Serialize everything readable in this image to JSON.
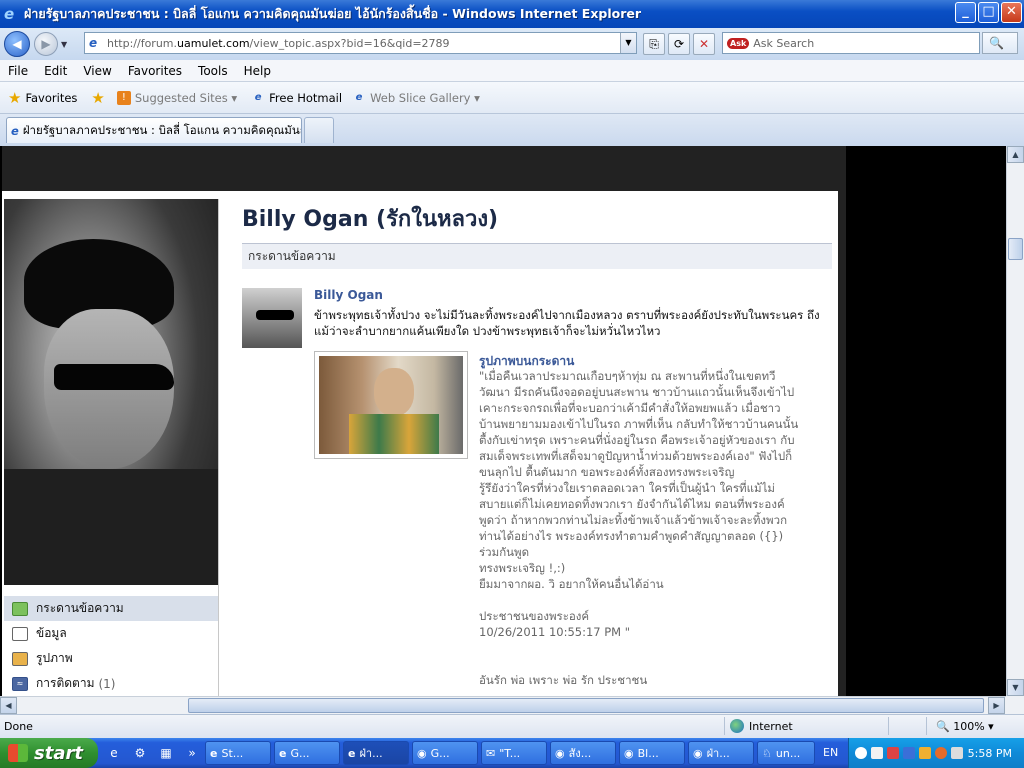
{
  "window": {
    "title": "ฝ่ายรัฐบาลภาคประชาชน : บิลลี่ โอแกน ความคิดคุณมันฆ่อย ไอ้นักร้องสิ้นชื่อ - Windows Internet Explorer",
    "min_glyph": "_",
    "max_glyph": "□",
    "close_glyph": "✕"
  },
  "nav": {
    "back_glyph": "◀",
    "forward_glyph": "▶",
    "dropdown_glyph": "▼",
    "address_prefix": "http://forum.",
    "address_host": "uamulet.com",
    "address_suffix": "/view_topic.aspx?bid=16&qid=2789",
    "compat_glyph": "⎘",
    "refresh_glyph": "⟳",
    "stop_glyph": "✕",
    "search_brand": "Ask",
    "search_placeholder": "Ask Search",
    "search_glyph": "🔍"
  },
  "menu": [
    "File",
    "Edit",
    "View",
    "Favorites",
    "Tools",
    "Help"
  ],
  "favbar": {
    "favorites_label": "Favorites",
    "items": [
      {
        "label": "Suggested Sites ▾",
        "icon": "suggested-sites-icon"
      },
      {
        "label": "Free Hotmail",
        "icon": "ie-page-icon"
      },
      {
        "label": "Web Slice Gallery ▾",
        "icon": "ie-page-icon"
      }
    ]
  },
  "tab": {
    "label": "ฝ่ายรัฐบาลภาคประชาชน : บิลลี่ โอแกน ความคิดคุณมันถ่..."
  },
  "page": {
    "title": "Billy Ogan (รักในหลวง)",
    "section_header": "กระดานข้อความ",
    "sidebar": [
      {
        "label": "กระดานข้อความ",
        "count": "",
        "icon": "wall-icon"
      },
      {
        "label": "ข้อมูล",
        "count": "",
        "icon": "info-icon"
      },
      {
        "label": "รูปภาพ",
        "count": "",
        "icon": "photos-icon"
      },
      {
        "label": "การติดตาม",
        "count": "(1)",
        "icon": "rss-icon"
      }
    ],
    "post": {
      "author": "Billy Ogan",
      "text": "ข้าพระพุทธเจ้าทั้งปวง จะไม่มีวันละทิ้งพระองค์ไปจากเมืองหลวง ตราบที่พระองค์ยังประทับในพระนคร ถึงแม้ว่าจะลำบากยากแค้นเพียงใด ปวงข้าพระพุทธเจ้าก็จะไม่หวั่นไหวไหว",
      "attachment_title": "รูปภาพบนกระดาน",
      "attachment_text": "\"เมื่อคืนเวลาประมาณเกือบๆห้าทุ่ม ณ สะพานที่หนึ่งในเขตทวีวัฒนา มีรถคันนึงจอดอยู่บนสะพาน ชาวบ้านแถวนั้นเห็นจึงเข้าไปเคาะกระจกรถเพื่อที่จะบอกว่าเค้ามีคำสั่งให้อพยพแล้ว เมื่อชาวบ้านพยายามมองเข้าไปในรถ ภาพที่เห็น กลับทำให้ชาวบ้านคนนั้นตื้งกับเข่าทรุด เพราะคนที่นั่งอยู่ในรถ คือพระเจ้าอยู่หัวของเรา กับสมเด็จพระเทพที่เสด็จมาดูปัญหาน้ำท่วมด้วยพระองค์เอง\" ฟังไปก็ขนลุกไป ตื้นตันมาก ขอพระองค์ทั้งสองทรงพระเจริญ\nรู้รึยังว่าใครที่ห่วงใยเราตลอดเวลา ใครที่เป็นผู้นำ ใครที่แม้ไม่สบายแต่ก็ไม่เคยทอดทิ้งพวกเรา ยังจำกันได้ไหม ตอนที่พระองค์พูดว่า ถ้าหากพวกท่านไม่ละทิ้งข้าพเจ้าแล้วข้าพเจ้าจะละทิ้งพวกท่านได้อย่างไร พระองค์ทรงทำตามคำพูดคำสัญญาตลอด ({}) ร่วมกันพูด\nทรงพระเจริญ !,:)\nยืมมาจากผอ. วิ อยากให้คนอื่นได้อ่าน\n\nประชาชนของพระองค์\n10/26/2011 10:55:17 PM \"\n\n\nอันรัก พ่อ เพราะ พ่อ รัก ประชาชน"
    }
  },
  "status": {
    "left": "Done",
    "zone": "Internet",
    "zoom": "🔍 100%  ▾"
  },
  "taskbar": {
    "start": "start",
    "quicklaunch": [
      "e",
      "⚙",
      "▦",
      "»"
    ],
    "tasks": [
      {
        "label": "St...",
        "icon": "e"
      },
      {
        "label": "G...",
        "icon": "e"
      },
      {
        "label": "ฝ่า...",
        "icon": "e"
      },
      {
        "label": "G...",
        "icon": "◉"
      },
      {
        "label": "\"T...",
        "icon": "✉"
      },
      {
        "label": "สัง...",
        "icon": "◉"
      },
      {
        "label": "Bl...",
        "icon": "◉"
      },
      {
        "label": "ฝ่า...",
        "icon": "◉"
      },
      {
        "label": "un...",
        "icon": "♘"
      }
    ],
    "language": "EN",
    "clock": "5:58 PM"
  }
}
